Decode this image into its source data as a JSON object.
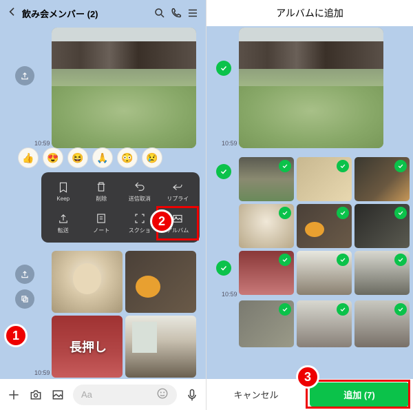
{
  "left": {
    "header": {
      "title": "飲み会メンバー (2)",
      "icons": [
        "search-icon",
        "phone-icon",
        "menu-icon"
      ]
    },
    "timestamps": {
      "t1": "10:59",
      "t2": "10:59"
    },
    "reactions": [
      "👍",
      "😍",
      "😆",
      "🙏",
      "😳",
      "😢"
    ],
    "context_menu": [
      {
        "label": "Keep",
        "icon": "bookmark-icon"
      },
      {
        "label": "削除",
        "icon": "trash-icon"
      },
      {
        "label": "送信取消",
        "icon": "undo-icon"
      },
      {
        "label": "リプライ",
        "icon": "reply-icon"
      },
      {
        "label": "転送",
        "icon": "share-icon"
      },
      {
        "label": "ノート",
        "icon": "note-icon"
      },
      {
        "label": "スクショ",
        "icon": "screenshot-icon"
      },
      {
        "label": "アルバム",
        "icon": "album-icon"
      }
    ],
    "longpress_label": "長押し",
    "input": {
      "placeholder": "Aa"
    }
  },
  "right": {
    "header_title": "アルバムに追加",
    "timestamps": {
      "t1": "10:59",
      "t2": "10:59"
    },
    "cancel_label": "キャンセル",
    "add_label": "追加 (7)",
    "selected_count": 7
  },
  "annotations": {
    "badge1": "1",
    "badge2": "2",
    "badge3": "3"
  },
  "colors": {
    "accent_green": "#0bc24a",
    "highlight_red": "#e00",
    "chat_bg": "#b6ceea"
  }
}
